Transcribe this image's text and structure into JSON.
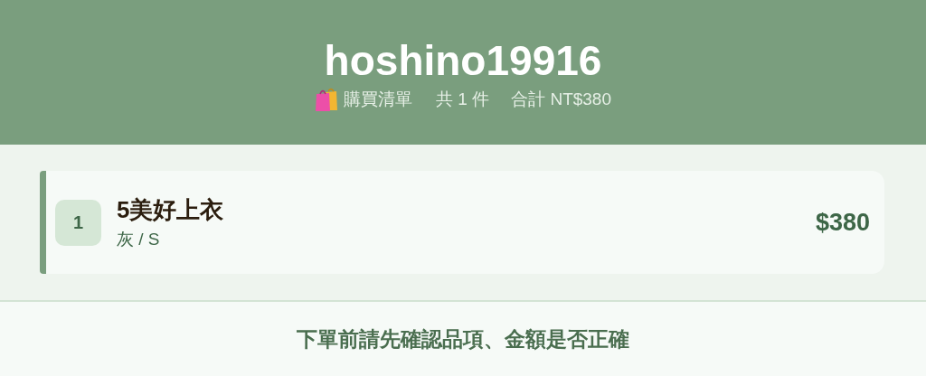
{
  "header": {
    "username": "hoshino19916",
    "list_label": "購買清單",
    "count": "共 1 件",
    "total": "合計 NT$380"
  },
  "items": [
    {
      "index": "1",
      "name": "5美好上衣",
      "variant": "灰 / S",
      "price": "$380"
    }
  ],
  "footer": {
    "notice": "下單前請先確認品項、金額是否正確"
  }
}
